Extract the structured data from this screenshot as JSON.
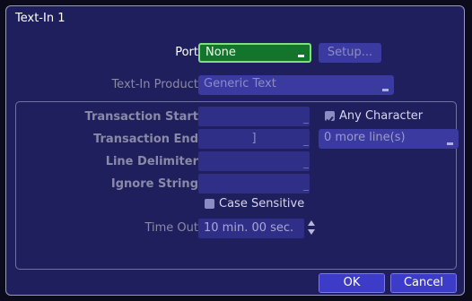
{
  "dialog": {
    "title": "Text-In 1"
  },
  "port": {
    "label": "Port",
    "value": "None",
    "setup_label": "Setup..."
  },
  "product": {
    "label": "Text-In Product",
    "value": "Generic Text"
  },
  "transaction_start": {
    "label": "Transaction Start",
    "value": ""
  },
  "any_character": {
    "label": "Any Character",
    "checked": true
  },
  "transaction_end": {
    "label": "Transaction End",
    "value": "]"
  },
  "more_lines": {
    "value": "0 more line(s)"
  },
  "line_delimiter": {
    "label": "Line Delimiter",
    "value": ""
  },
  "ignore_string": {
    "label": "Ignore String",
    "value": ""
  },
  "case_sensitive": {
    "label": "Case Sensitive",
    "checked": false
  },
  "timeout": {
    "label": "Time Out",
    "value": "10 min. 00 sec."
  },
  "footer": {
    "ok_label": "OK",
    "cancel_label": "Cancel"
  }
}
